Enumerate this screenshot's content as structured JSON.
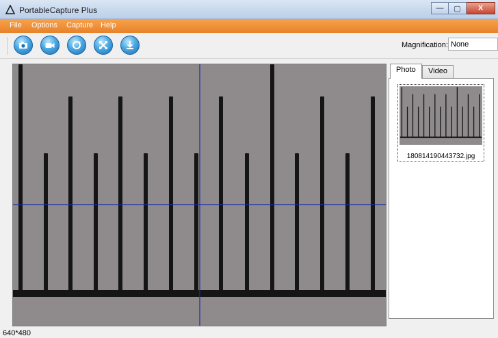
{
  "window": {
    "title": "PortableCapture Plus",
    "controls": {
      "minimize": "—",
      "maximize": "▢",
      "close": "X"
    }
  },
  "menu": [
    "File",
    "Options",
    "Capture",
    "Help"
  ],
  "toolbar": {
    "buttons": [
      {
        "icon": "camera-photo-icon"
      },
      {
        "icon": "video-camera-icon"
      },
      {
        "icon": "refresh-icon"
      },
      {
        "icon": "fullscreen-icon"
      },
      {
        "icon": "download-icon"
      }
    ]
  },
  "magnification": {
    "label": "Magnification:",
    "value": "None"
  },
  "tabs": [
    {
      "label": "Photo",
      "active": true
    },
    {
      "label": "Video",
      "active": false
    }
  ],
  "gallery": [
    {
      "filename": "180814190443732.jpg"
    }
  ],
  "status": {
    "resolution": "640*480"
  },
  "colors": {
    "menubar": "#ee8a30",
    "crosshair": "#1a2fa8",
    "ruler_tick": "#151515",
    "preview_bg": "#8f8a8c"
  }
}
